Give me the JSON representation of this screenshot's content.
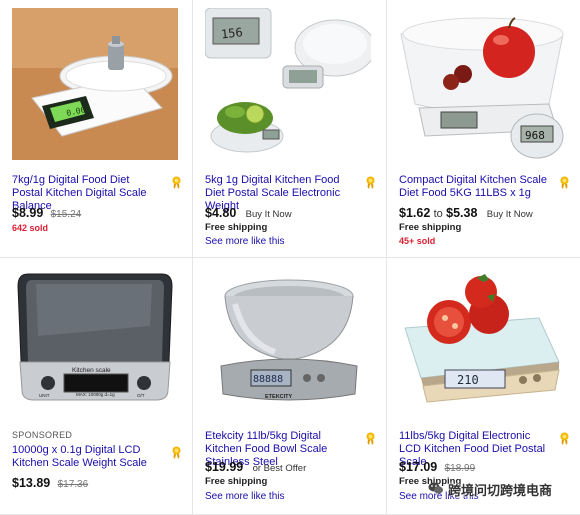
{
  "listings": [
    {
      "title": "7kg/1g Digital Food Diet Postal Kitchen Digital Scale Balance",
      "price": "$8.99",
      "was_price": "$15.24",
      "sold": "642 sold",
      "badge_icon": "top-rated-ribbon-icon",
      "display_reading": "0.000"
    },
    {
      "title": "5kg 1g Digital Kitchen Food Diet Postal Scale Electronic Weight",
      "price": "$4.80",
      "format": "Buy It Now",
      "shipping": "Free shipping",
      "more_link": "See more like this",
      "badge_icon": "top-rated-ribbon-icon",
      "display_reading": "156"
    },
    {
      "title": "Compact Digital Kitchen Scale Diet Food 5KG 11LBS x 1g",
      "price_low": "$1.62",
      "price_to": "to",
      "price_high": "$5.38",
      "format": "Buy It Now",
      "shipping": "Free shipping",
      "sold": "45+ sold",
      "badge_icon": "top-rated-ribbon-icon",
      "display_reading": "968"
    },
    {
      "sponsored": "SPONSORED",
      "title": "10000g x 0.1g Digital LCD Kitchen Scale Weight Scale",
      "price": "$13.89",
      "was_price": "$17.36",
      "badge_icon": "top-rated-ribbon-icon",
      "scale_label": "Kitchen scale",
      "scale_spec": "MAX: 10000g d=1g",
      "scale_buttons": [
        "UNIT",
        "O/T"
      ]
    },
    {
      "title": "Etekcity 11lb/5kg Digital Kitchen Food Bowl Scale Stainless Steel",
      "price": "$19.99",
      "format": "or Best Offer",
      "shipping": "Free shipping",
      "more_link": "See more like this",
      "badge_icon": "top-rated-ribbon-icon",
      "brand": "ETEKCITY",
      "display_reading": "88888"
    },
    {
      "title": "11lbs/5kg Digital Electronic LCD Kitchen Food Diet Postal Scale",
      "price": "$17.09",
      "was_price": "$18.99",
      "shipping": "Free shipping",
      "more_link": "See more like this",
      "badge_icon": "top-rated-ribbon-icon",
      "display_reading": "210"
    }
  ],
  "watermark": {
    "text": "跨境问切跨境电商",
    "icon": "wechat-icon"
  },
  "colors": {
    "link": "#1a0dab",
    "sold": "#dd1e31",
    "badge": "#f2b705"
  }
}
